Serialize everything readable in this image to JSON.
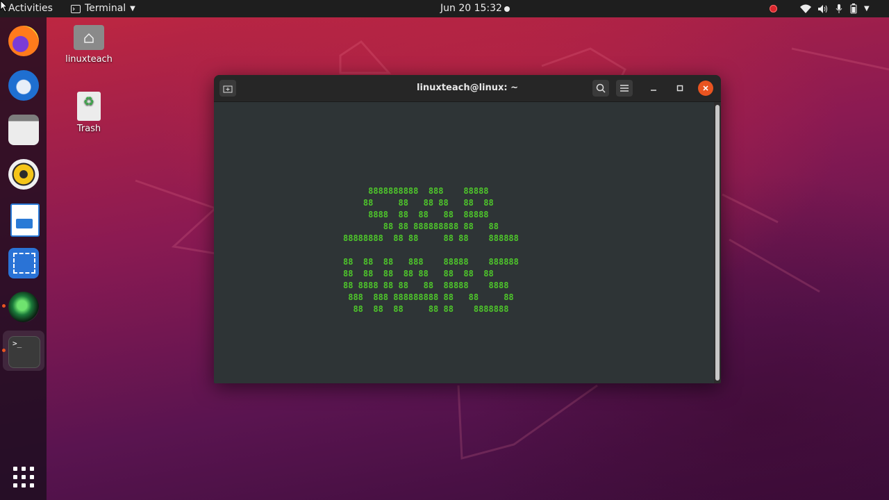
{
  "topbar": {
    "activities": "Activities",
    "app_menu": "Terminal",
    "clock": "Jun 20  15:32"
  },
  "dock": {
    "items": [
      {
        "name": "Firefox",
        "icon": "firefox-icon"
      },
      {
        "name": "Thunderbird",
        "icon": "thunderbird-icon"
      },
      {
        "name": "Files",
        "icon": "files-icon"
      },
      {
        "name": "Rhythmbox",
        "icon": "rhythmbox-icon"
      },
      {
        "name": "LibreOffice Writer",
        "icon": "writer-icon"
      },
      {
        "name": "Screenshot",
        "icon": "screenshot-icon"
      },
      {
        "name": "Webcam",
        "icon": "webcam-icon"
      },
      {
        "name": "Terminal",
        "icon": "terminal-icon"
      },
      {
        "name": "Show Applications",
        "icon": "app-grid-icon"
      }
    ]
  },
  "desktop": {
    "home_label": "linuxteach",
    "trash_label": "Trash"
  },
  "terminal": {
    "title": "linuxteach@linux: ~",
    "ascii_art": "     8888888888  888    88888\n    88     88   88 88   88  88\n     8888  88  88   88  88888\n        88 88 888888888 88   88\n88888888  88 88     88 88    888888\n\n88  88  88   888    88888    888888\n88  88  88  88 88   88  88  88\n88 8888 88 88   88  88888    8888\n 888  888 888888888 88   88     88\n  88  88  88     88 88    8888888"
  },
  "colors": {
    "terminal_text": "#4ec52b",
    "close_button": "#e95420",
    "accent": "#e95420"
  }
}
